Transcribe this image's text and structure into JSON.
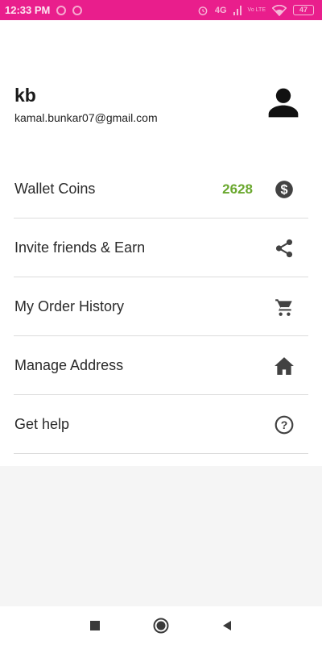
{
  "status_bar": {
    "time": "12:33 PM",
    "network": "4G",
    "lte": "Vo LTE",
    "battery": "47"
  },
  "profile": {
    "name": "kb",
    "email": "kamal.bunkar07@gmail.com",
    "avatar_icon": "person-icon"
  },
  "menu": {
    "items": [
      {
        "label": "Wallet Coins",
        "value": "2628",
        "icon": "coin-dollar-icon"
      },
      {
        "label": "Invite friends & Earn",
        "icon": "share-icon"
      },
      {
        "label": "My Order History",
        "icon": "cart-icon"
      },
      {
        "label": "Manage Address",
        "icon": "home-icon"
      },
      {
        "label": "Get help",
        "icon": "help-icon"
      }
    ]
  },
  "colors": {
    "status_bar": "#e91e8c",
    "accent_value": "#6aa82e",
    "icon": "#424242"
  },
  "nav": {
    "buttons": [
      "recent-apps-icon",
      "home-circle-icon",
      "back-icon"
    ]
  }
}
